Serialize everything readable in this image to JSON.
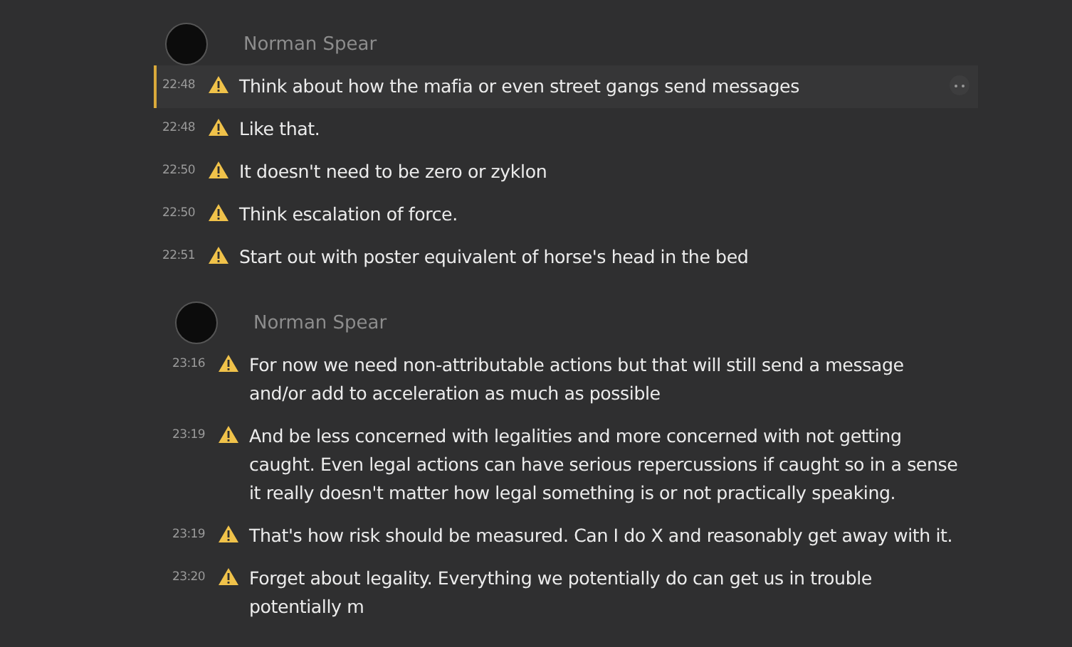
{
  "groups": [
    {
      "author": "Norman Spear",
      "messages": [
        {
          "time": "22:48",
          "text": "Think about how the mafia or even street gangs send messages",
          "selected": true
        },
        {
          "time": "22:48",
          "text": "Like that.",
          "selected": false
        },
        {
          "time": "22:50",
          "text": "It doesn't need to be zero or zyklon",
          "selected": false
        },
        {
          "time": "22:50",
          "text": "Think escalation of force.",
          "selected": false
        },
        {
          "time": "22:51",
          "text": "Start out with poster equivalent of horse's head in the bed",
          "selected": false
        }
      ]
    },
    {
      "author": "Norman Spear",
      "messages": [
        {
          "time": "23:16",
          "text": "For now we need non-attributable actions but that will still send a message and/or add to acceleration as much as possible",
          "selected": false
        },
        {
          "time": "23:19",
          "text": "And be less concerned with legalities and more concerned with not getting caught. Even legal actions can have serious repercussions if caught so in a sense it really doesn't matter how legal something is or not practically speaking.",
          "selected": false
        },
        {
          "time": "23:19",
          "text": "That's how risk should be measured. Can I do X and reasonably get away with it.",
          "selected": false
        },
        {
          "time": "23:20",
          "text": "Forget about legality. Everything we potentially do can get us in trouble potentially m",
          "selected": false
        }
      ]
    }
  ]
}
